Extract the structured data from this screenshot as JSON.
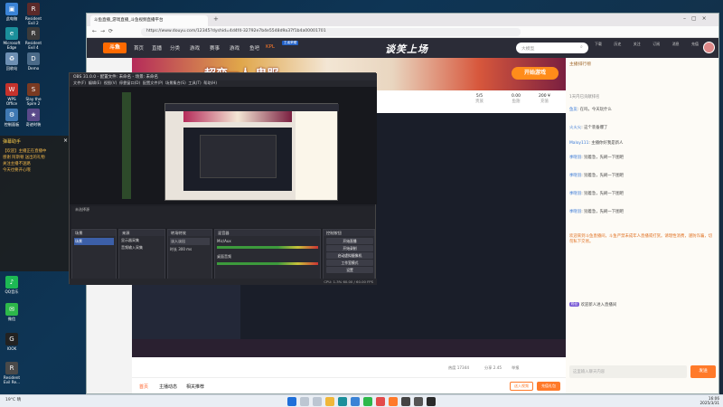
{
  "desktop": {
    "icons": [
      {
        "label": "此电脑",
        "color": "#3a83d6",
        "glyph": "▣"
      },
      {
        "label": "Resident Evil 2",
        "color": "#5b2a2a",
        "glyph": "R"
      },
      {
        "label": "Microsoft Edge",
        "color": "#1b8f9b",
        "glyph": "e"
      },
      {
        "label": "Resident Evil 4",
        "color": "#3b3b3b",
        "glyph": "R"
      },
      {
        "label": "回收站",
        "color": "#6d8fb3",
        "glyph": "♻"
      },
      {
        "label": "Demo",
        "color": "#4a6a88",
        "glyph": "D"
      },
      {
        "label": "WPS Office",
        "color": "#c5322c",
        "glyph": "W"
      },
      {
        "label": "Slay the Spire 2",
        "color": "#7a3a22",
        "glyph": "S"
      },
      {
        "label": "控制面板",
        "color": "#3f78b3",
        "glyph": "⚙"
      },
      {
        "label": "奇迹时装",
        "color": "#5a4a8a",
        "glyph": "★"
      },
      {
        "label": "QQ音乐",
        "color": "#1db954",
        "glyph": "♪"
      },
      {
        "label": "微信",
        "color": "#2db84a",
        "glyph": "✉"
      },
      {
        "label": "IOOK",
        "color": "#222222",
        "glyph": "G"
      },
      {
        "label": "Resident Evil Re...",
        "color": "#4a4a4a",
        "glyph": "R"
      }
    ],
    "weather": {
      "temp": "19°C",
      "desc": "晴"
    }
  },
  "browser": {
    "tabs": [
      {
        "label": "斗鱼直播_游戏直播_斗鱼视频直播平台"
      }
    ],
    "url": "https://www.douyu.com/12345?dyshid=4d4f4-32792e7b4e5548d9a37f1b4a00001701",
    "site": {
      "logo": "斗鱼",
      "nav": [
        "首页",
        "直播",
        "分类",
        "游戏",
        "赛事",
        "游戏",
        "鱼吧",
        "KPL"
      ],
      "kpl_badge": "王者荣耀",
      "search_placeholder": "大模型",
      "right_nav": [
        "下载",
        "历史",
        "关注",
        "订阅",
        "消息",
        "充值"
      ]
    },
    "banner": {
      "title": "超变一人 鬼服",
      "slogan": "谈笑上场",
      "play_button": "开始游戏",
      "stats": [
        {
          "value": "5/5",
          "label": "贵族"
        },
        {
          "value": "0.00",
          "label": "鱼翅"
        },
        {
          "value": "200 ¥",
          "label": "充值"
        }
      ]
    },
    "room_bottom": {
      "tabs": [
        "首页",
        "主播动态",
        "相关推荐"
      ],
      "viewers": "热度 17344",
      "share": "分享 2.45",
      "report": "举报",
      "btn_follow": "送入视频",
      "btn_gift": "充值礼包"
    },
    "chat": {
      "header": "主播排行榜",
      "rank_note": "1天内已贡献排名",
      "messages": [
        {
          "user": "鱼友",
          "text": "在吗，今天玩什么"
        },
        {
          "user": "火火火",
          "text": "这个装备爆了"
        },
        {
          "user": "Maloy111",
          "text": "主播你好我是新人"
        },
        {
          "user": "季晓羽",
          "text": "别着急，先刷一下图吧"
        },
        {
          "user": "季晓羽",
          "text": "别着急，先刷一下图吧"
        },
        {
          "user": "季晓羽",
          "text": "别着急，先刷一下图吧"
        },
        {
          "user": "季晓羽",
          "text": "别着急，先刷一下图吧"
        }
      ],
      "notice": "欢迎来到斗鱼直播间，斗鱼严禁未成年人直播或打赏。请理性消费，谨防诈骗，切勿私下交易。",
      "system_user": "粉丝",
      "system_text": "欢迎新人进入直播间",
      "input_placeholder": "这里输入聊天内容",
      "send": "发送"
    }
  },
  "obs": {
    "title": "OBS 31.0.0 - 配置文件: 未命名 - 场景: 未命名",
    "menu": [
      "文件(F)",
      "编辑(E)",
      "视图(V)",
      "停靠窗口(D)",
      "配置文件(P)",
      "场景集合(S)",
      "工具(T)",
      "帮助(H)"
    ],
    "docks": [
      {
        "title": "场景",
        "items": [
          "场景"
        ]
      },
      {
        "title": "来源",
        "items": [
          "显示器采集",
          "音频输入采集"
        ]
      },
      {
        "title": "转场特效",
        "items": [
          "淡入淡出",
          "时长 300 ms"
        ]
      },
      {
        "title": "混音器",
        "items": [
          "Mic/Aux",
          "桌面音频"
        ]
      },
      {
        "title": "控制按钮",
        "items": [
          "开始直播",
          "开始录制",
          "启动虚拟摄像机",
          "工作室模式",
          "设置",
          "退出"
        ]
      }
    ],
    "source_label": "未选择源",
    "status": "CPU: 1.3%  60.00 / 60.00 FPS"
  },
  "left_panel": {
    "title": "弹幕助手",
    "lines": [
      "【欢迎】主播正在直播中",
      "感谢 阿斯顿 送出的礼物",
      "关注主播不迷路",
      "今天也要开心哦"
    ]
  },
  "taskbar": {
    "time": "16:06",
    "date": "2025/3/31"
  }
}
